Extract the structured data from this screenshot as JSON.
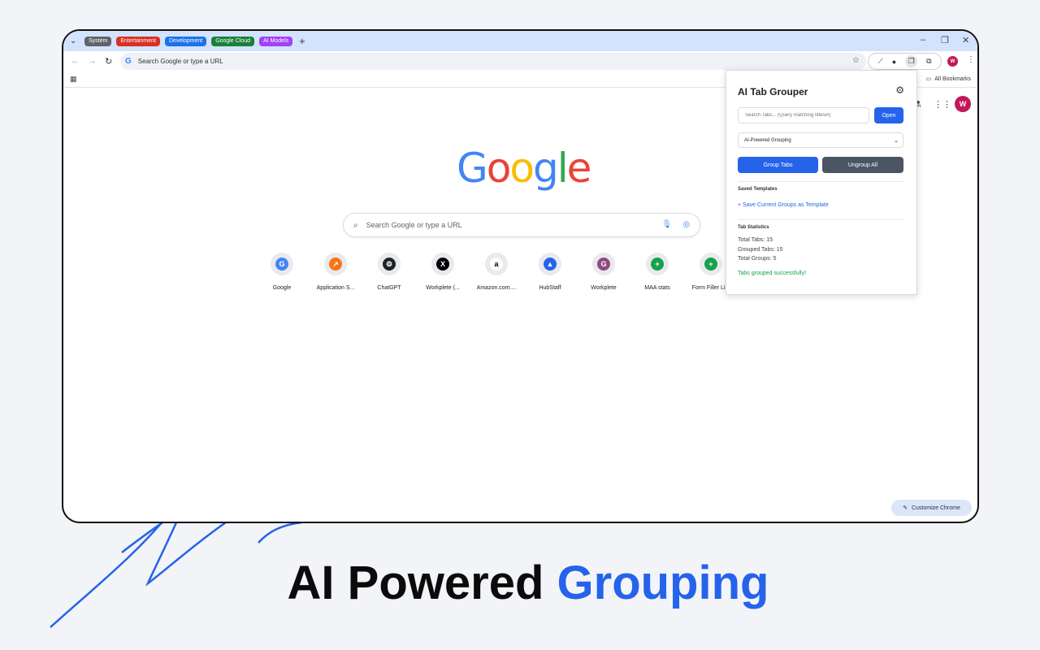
{
  "tab_groups": [
    {
      "label": "System",
      "color": "#5f6368"
    },
    {
      "label": "Entertainment",
      "color": "#d93025"
    },
    {
      "label": "Development",
      "color": "#1a73e8"
    },
    {
      "label": "Google Cloud",
      "color": "#188038"
    },
    {
      "label": "AI Models",
      "color": "#a142f4"
    }
  ],
  "toolbar": {
    "omnibox_text": "Search Google or type a URL",
    "avatar_letter": "W"
  },
  "bookmarks": {
    "all_bookmarks_label": "All Bookmarks"
  },
  "ntp": {
    "logo_letters": [
      "G",
      "o",
      "o",
      "g",
      "l",
      "e"
    ],
    "search_placeholder": "Search Google or type a URL",
    "avatar_letter": "W",
    "customize_label": "Customize Chrome",
    "shortcuts": [
      {
        "label": "Google",
        "icon": "google-icon",
        "color": "#4285f4",
        "glyph": "G"
      },
      {
        "label": "Application S...",
        "icon": "application-icon",
        "color": "#f97316",
        "glyph": "↗"
      },
      {
        "label": "ChatGPT",
        "icon": "chatgpt-icon",
        "color": "#202124",
        "glyph": "⚙"
      },
      {
        "label": "Workplete (...",
        "icon": "x-icon",
        "color": "#000000",
        "glyph": "X"
      },
      {
        "label": "Amazon.com....",
        "icon": "amazon-icon",
        "color": "#ffffff",
        "glyph": "a"
      },
      {
        "label": "HubStaff",
        "icon": "hubstaff-icon",
        "color": "#2563eb",
        "glyph": "▲"
      },
      {
        "label": "Workplete",
        "icon": "workplete-icon",
        "color": "#8e4b7f",
        "glyph": "G"
      },
      {
        "label": "MAA stats",
        "icon": "sheets-icon",
        "color": "#16a34a",
        "glyph": "+"
      },
      {
        "label": "Form Filler Li...",
        "icon": "sheets-icon",
        "color": "#16a34a",
        "glyph": "+"
      }
    ]
  },
  "popup": {
    "title": "AI Tab Grouper",
    "search_placeholder": "Search Tabs... (Query matching title/url)",
    "open_label": "Open",
    "mode_selected": "AI-Powered Grouping",
    "group_label": "Group Tabs",
    "ungroup_label": "Ungroup All",
    "templates_heading": "Saved Templates",
    "save_template_label": "+ Save Current Groups as Template",
    "stats_heading": "Tab Statistics",
    "total_tabs": "Total Tabs: 15",
    "grouped_tabs": "Grouped Tabs: 15",
    "total_groups": "Total Groups: 5",
    "status": "Tabs grouped successfully!"
  },
  "headline": {
    "plain": "AI Powered",
    "accent": "Grouping"
  },
  "colors": {
    "accent": "#2563eb",
    "secondary_button": "#4b5563",
    "success": "#16a34a"
  }
}
